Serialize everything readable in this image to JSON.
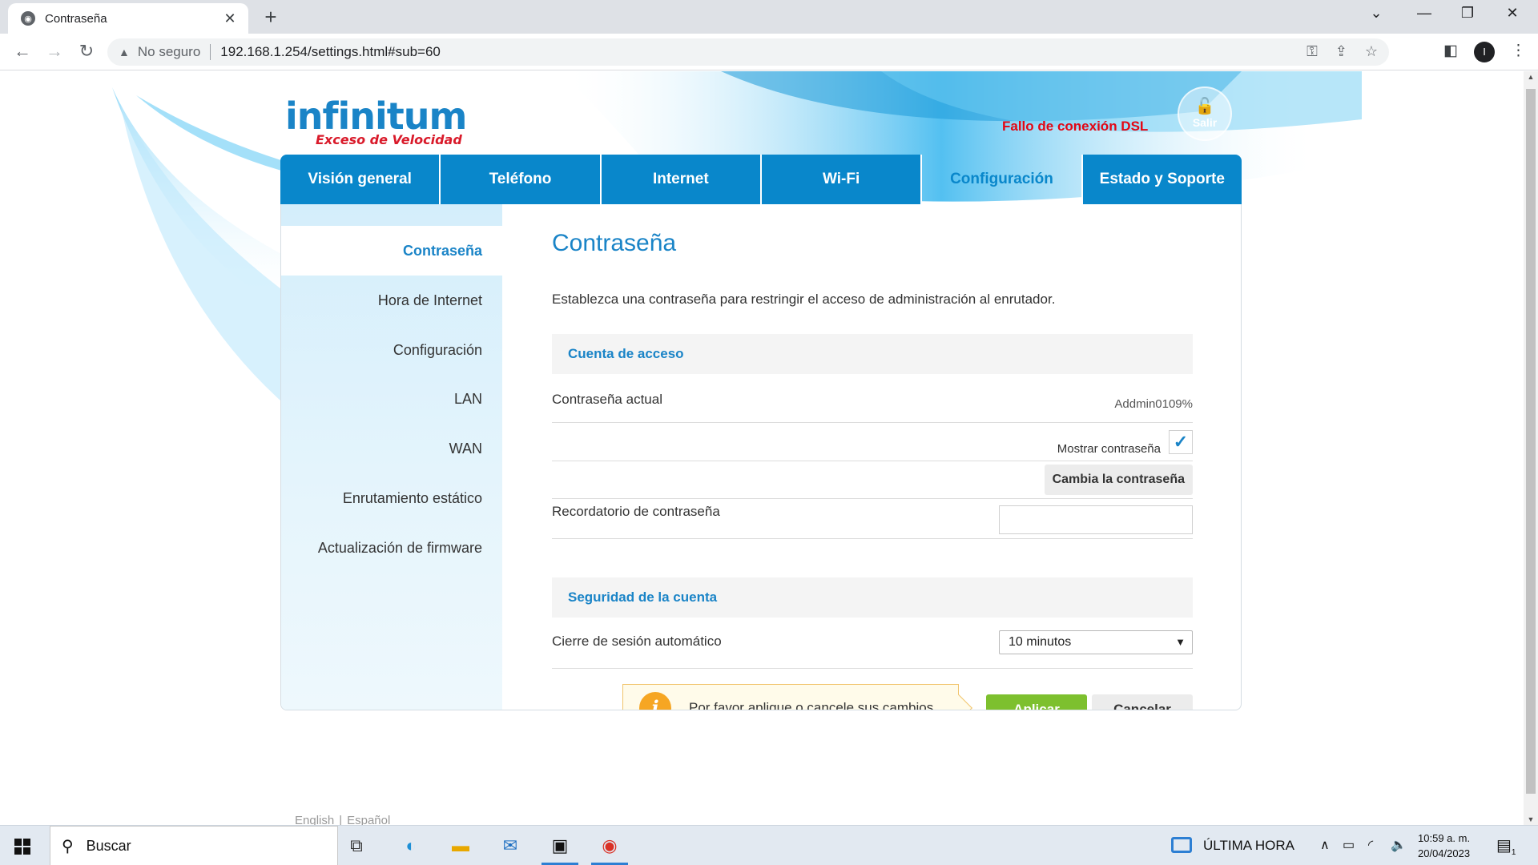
{
  "browser": {
    "tab_title": "Contraseña",
    "security_label": "No seguro",
    "url": "192.168.1.254/settings.html#sub=60",
    "profile_initial": "I"
  },
  "header": {
    "brand": "infinitum",
    "tagline": "Exceso de Velocidad",
    "dsl_status": "Fallo de conexión DSL",
    "logout_label": "Salir"
  },
  "main_nav": {
    "tabs": [
      {
        "label": "Visión general",
        "active": false
      },
      {
        "label": "Teléfono",
        "active": false
      },
      {
        "label": "Internet",
        "active": false
      },
      {
        "label": "Wi-Fi",
        "active": false
      },
      {
        "label": "Configuración",
        "active": true
      },
      {
        "label": "Estado y Soporte",
        "active": false
      }
    ]
  },
  "sidebar": {
    "items": [
      {
        "label": "Contraseña",
        "active": true
      },
      {
        "label": "Hora de Internet",
        "active": false
      },
      {
        "label": "Configuración",
        "active": false
      },
      {
        "label": "LAN",
        "active": false
      },
      {
        "label": "WAN",
        "active": false
      },
      {
        "label": "Enrutamiento estático",
        "active": false
      },
      {
        "label": "Actualización de firmware",
        "active": false
      }
    ]
  },
  "content": {
    "title": "Contraseña",
    "description": "Establezca una contraseña para restringir el acceso de administración al enrutador.",
    "access_section": {
      "heading": "Cuenta de acceso",
      "current_password_label": "Contraseña actual",
      "current_password_value": "Addmin0109%",
      "show_password_label": "Mostrar contraseña",
      "show_password_checked": true,
      "change_password_button": "Cambia la contraseña",
      "reminder_label": "Recordatorio de contraseña",
      "reminder_value": ""
    },
    "security_section": {
      "heading": "Seguridad de la cuenta",
      "auto_logout_label": "Cierre de sesión automático",
      "auto_logout_value": "10 minutos"
    },
    "notice": "Por favor aplique o cancele sus cambios.",
    "apply_button": "Aplicar",
    "cancel_button": "Cancelar"
  },
  "footer": {
    "languages": [
      "English",
      "Español"
    ]
  },
  "taskbar": {
    "search_placeholder": "Buscar",
    "news_label": "ÚLTIMA HORA",
    "time": "10:59 a. m.",
    "date": "20/04/2023",
    "notification_count": "1"
  },
  "colors": {
    "brand_blue": "#0987cb",
    "error_red": "#e30613",
    "apply_green": "#7dc02e",
    "notice_orange": "#f6a623"
  }
}
